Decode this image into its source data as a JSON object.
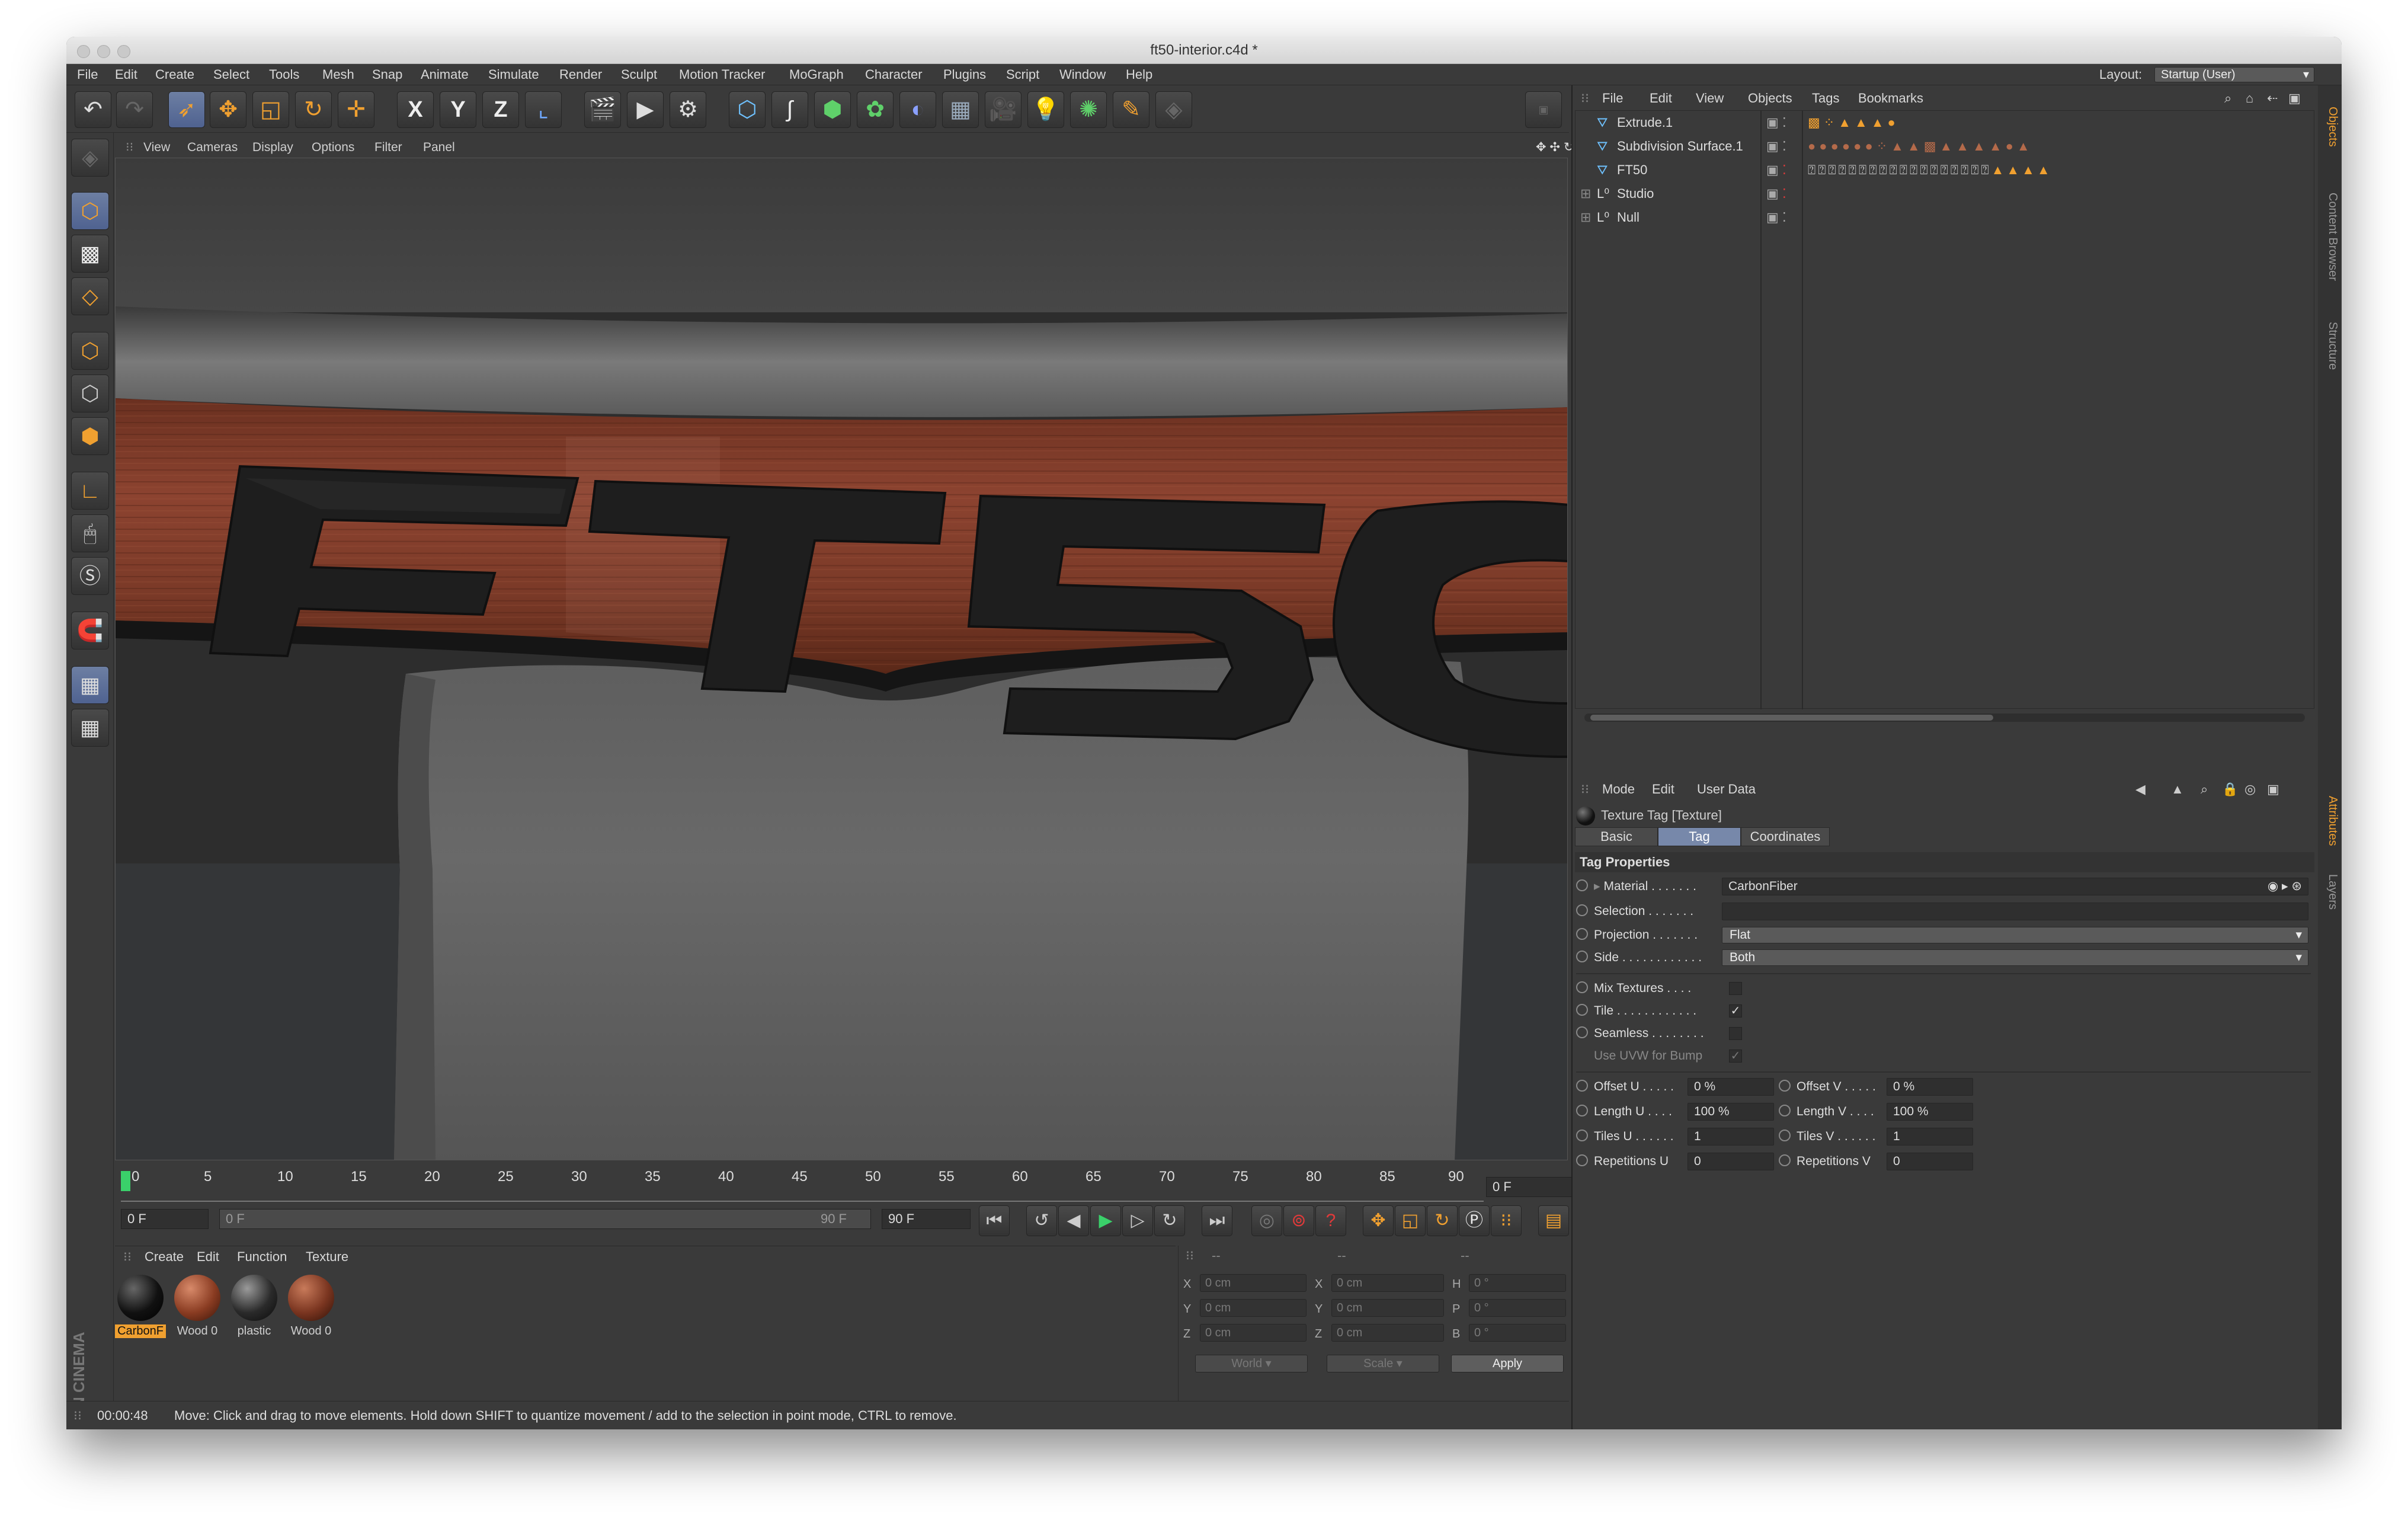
{
  "window": {
    "title": "ft50-interior.c4d *"
  },
  "menubar": {
    "items": [
      "File",
      "Edit",
      "Create",
      "Select",
      "Tools",
      "Mesh",
      "Snap",
      "Animate",
      "Simulate",
      "Render",
      "Sculpt",
      "Motion Tracker",
      "MoGraph",
      "Character",
      "Plugins",
      "Script",
      "Window",
      "Help"
    ],
    "layout_label": "Layout:",
    "layout_value": "Startup (User)"
  },
  "toolbar": {
    "icons": [
      "undo-icon",
      "redo-icon",
      "live-selection-icon",
      "move-icon",
      "scale-icon",
      "rotate-icon",
      "last-tool-icon",
      "x-axis-icon",
      "y-axis-icon",
      "z-axis-icon",
      "coordinate-system-icon",
      "render-view-icon",
      "render-picture-viewer-icon",
      "render-settings-icon",
      "cube-icon",
      "spline-pen-icon",
      "subdivision-surface-icon",
      "array-icon",
      "deformer-icon",
      "floor-icon",
      "camera-icon",
      "light-icon",
      "mograph-cloner-icon",
      "sculpt-brush-icon",
      "disabled-tool-icon"
    ],
    "axis_labels": [
      "X",
      "Y",
      "Z"
    ]
  },
  "viewport": {
    "menu": [
      "View",
      "Cameras",
      "Display",
      "Options",
      "Filter",
      "Panel"
    ],
    "logo_text": "FT5C"
  },
  "timeline": {
    "ticks": [
      "0",
      "5",
      "10",
      "15",
      "20",
      "25",
      "30",
      "35",
      "40",
      "45",
      "50",
      "55",
      "60",
      "65",
      "70",
      "75",
      "80",
      "85",
      "90"
    ],
    "current_frame": "0 F",
    "start_frame": "0 F",
    "range_start": "0 F",
    "range_end": "90 F",
    "end_frame": "90 F"
  },
  "materials": {
    "menu": [
      "Create",
      "Edit",
      "Function",
      "Texture"
    ],
    "items": [
      {
        "label": "CarbonF",
        "color": "#111111"
      },
      {
        "label": "Wood 0",
        "color": "#8a3c22"
      },
      {
        "label": "plastic",
        "color": "#2a2a2a"
      },
      {
        "label": "Wood 0",
        "color": "#7a3520"
      }
    ]
  },
  "coordinates": {
    "headers": [
      "--",
      "--",
      "--"
    ],
    "rows": [
      {
        "a": "X",
        "av": "0 cm",
        "b": "X",
        "bv": "0 cm",
        "c": "H",
        "cv": "0 °"
      },
      {
        "a": "Y",
        "av": "0 cm",
        "b": "Y",
        "bv": "0 cm",
        "c": "P",
        "cv": "0 °"
      },
      {
        "a": "Z",
        "av": "0 cm",
        "b": "Z",
        "bv": "0 cm",
        "c": "B",
        "cv": "0 °"
      }
    ],
    "mode1": "World",
    "mode2": "Scale",
    "apply": "Apply"
  },
  "status": {
    "time": "00:00:48",
    "message": "Move: Click and drag to move elements. Hold down SHIFT to quantize movement / add to the selection in point mode, CTRL to remove."
  },
  "object_manager": {
    "menu": [
      "File",
      "Edit",
      "View",
      "Objects",
      "Tags",
      "Bookmarks"
    ],
    "objects": [
      {
        "name": "Extrude.1",
        "type": "extrude"
      },
      {
        "name": "Subdivision Surface.1",
        "type": "subdivision"
      },
      {
        "name": "FT50",
        "type": "extrude"
      },
      {
        "name": "Studio",
        "type": "null"
      },
      {
        "name": "Null",
        "type": "null"
      }
    ]
  },
  "attributes": {
    "menu": [
      "Mode",
      "Edit",
      "User Data"
    ],
    "header": "Texture Tag [Texture]",
    "tabs": [
      "Basic",
      "Tag",
      "Coordinates"
    ],
    "active_tab": "Tag",
    "section": "Tag Properties",
    "material_label": "Material . . . . . . .",
    "material_value": "CarbonFiber",
    "selection_label": "Selection . . . . . . .",
    "selection_value": "",
    "projection_label": "Projection . . . . . . .",
    "projection_value": "Flat",
    "side_label": "Side . . . . . . . . . . . .",
    "side_value": "Both",
    "mix_label": "Mix Textures . . . .",
    "tile_label": "Tile . . . . . . . . . . . .",
    "seamless_label": "Seamless . . . . . . . .",
    "uvw_label": "Use UVW for Bump",
    "offset_u_label": "Offset U . . . . .",
    "offset_u": "0 %",
    "offset_v_label": "Offset V . . . . .",
    "offset_v": "0 %",
    "length_u_label": "Length U . . . .",
    "length_u": "100 %",
    "length_v_label": "Length V . . . .",
    "length_v": "100 %",
    "tiles_u_label": "Tiles U . . . . . .",
    "tiles_u": "1",
    "tiles_v_label": "Tiles V . . . . . .",
    "tiles_v": "1",
    "rep_u_label": "Repetitions U",
    "rep_u": "0",
    "rep_v_label": "Repetitions V",
    "rep_v": "0"
  },
  "side_tabs": [
    "Objects",
    "Content Browser",
    "Structure",
    "Attributes",
    "Layers"
  ],
  "colors": {
    "accent": "#f0a030",
    "selected_tab": "#7788aa",
    "panel": "#3a3a3a"
  }
}
